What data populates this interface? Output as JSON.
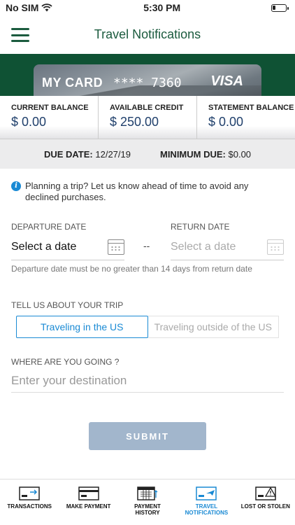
{
  "status": {
    "carrier": "No SIM",
    "time": "5:30 PM"
  },
  "header": {
    "title": "Travel Notifications"
  },
  "card": {
    "name": "MY CARD",
    "masked_number": "**** 7360",
    "brand": "VISA"
  },
  "balances": [
    {
      "label": "CURRENT BALANCE",
      "value": "$ 0.00"
    },
    {
      "label": "AVAILABLE CREDIT",
      "value": "$ 250.00"
    },
    {
      "label": "STATEMENT BALANCE",
      "value": "$ 0.00"
    }
  ],
  "due": {
    "due_label": "DUE DATE:",
    "due_value": "12/27/19",
    "min_label": "MINIMUM DUE:",
    "min_value": "$0.00"
  },
  "info_text": "Planning a trip? Let us know ahead of time to avoid any declined purchases.",
  "form": {
    "departure_label": "DEPARTURE DATE",
    "departure_value": "Select a date",
    "separator": "--",
    "return_label": "RETURN DATE",
    "return_placeholder": "Select a date",
    "hint": "Departure date must be no greater than 14 days from return date",
    "trip_label": "TELL US ABOUT YOUR TRIP",
    "trip_options": [
      "Traveling in the US",
      "Traveling outside of the US"
    ],
    "destination_label": "WHERE ARE YOU GOING ?",
    "destination_placeholder": "Enter your destination",
    "submit_label": "SUBMIT"
  },
  "tabs": [
    {
      "label": "TRANSACTIONS",
      "icon": "transactions-icon"
    },
    {
      "label": "MAKE PAYMENT",
      "icon": "make-payment-icon"
    },
    {
      "label": "PAYMENT\nHISTORY",
      "icon": "payment-history-icon"
    },
    {
      "label": "TRAVEL\nNOTIFICATIONS",
      "icon": "travel-notifications-icon",
      "active": true
    },
    {
      "label": "LOST OR STOLEN",
      "icon": "lost-or-stolen-icon"
    }
  ],
  "colors": {
    "brand_green": "#0f5234",
    "accent_blue": "#1a8ad4",
    "submit_disabled": "#a2b6cc"
  }
}
